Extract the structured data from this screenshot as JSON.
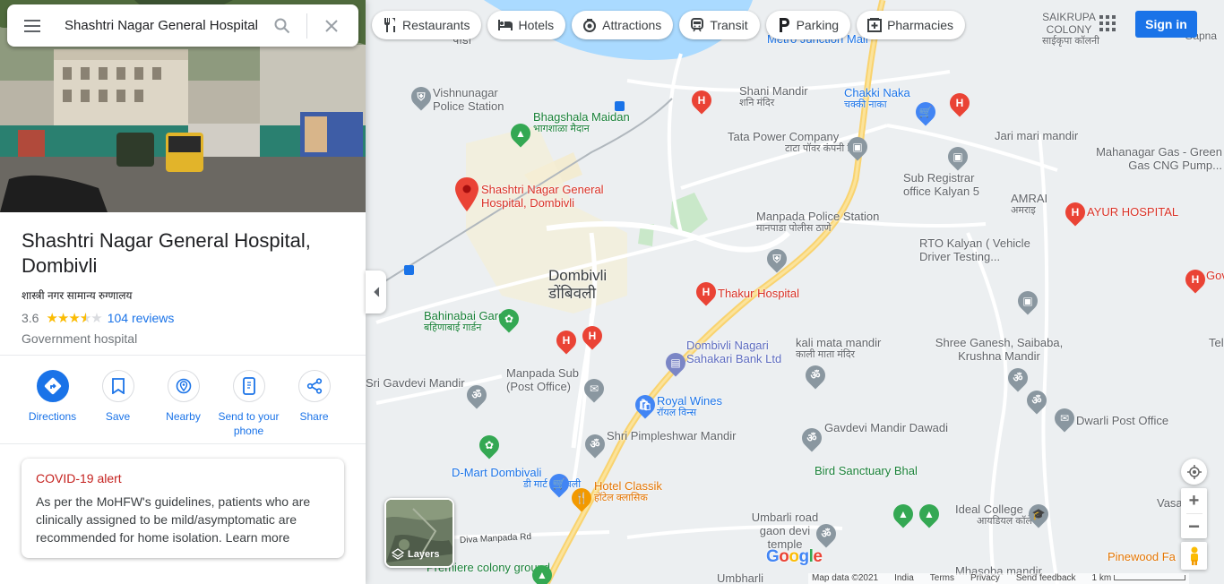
{
  "search": {
    "value": "Shashtri Nagar General Hospital, Dombivli"
  },
  "place": {
    "title": "Shashtri Nagar General Hospital, Dombivli",
    "subtitle": "शास्त्री नगर सामान्य रुग्णालय",
    "rating": "3.6",
    "rating_value": 3.6,
    "reviews": "104 reviews",
    "category": "Government hospital"
  },
  "actions": [
    {
      "label": "Directions",
      "icon": "directions-icon"
    },
    {
      "label": "Save",
      "icon": "bookmark-icon"
    },
    {
      "label": "Nearby",
      "icon": "nearby-icon"
    },
    {
      "label": "Send to your phone",
      "icon": "phone-icon"
    },
    {
      "label": "Share",
      "icon": "share-icon"
    }
  ],
  "covid": {
    "title": "COVID-19 alert",
    "text": "As per the MoHFW's guidelines, patients who are clinically assigned to be mild/asymptomatic are recommended for home isolation.",
    "link": "Learn more"
  },
  "chips": [
    {
      "label": "Restaurants",
      "icon": "fork-knife-icon"
    },
    {
      "label": "Hotels",
      "icon": "bed-icon"
    },
    {
      "label": "Attractions",
      "icon": "camera-icon"
    },
    {
      "label": "Transit",
      "icon": "train-icon"
    },
    {
      "label": "Parking",
      "icon": "parking-icon"
    },
    {
      "label": "Pharmacies",
      "icon": "pharmacy-icon"
    }
  ],
  "header": {
    "signin": "Sign in"
  },
  "layers": {
    "label": "Layers"
  },
  "footer": {
    "map_data": "Map data ©2021",
    "country": "India",
    "terms": "Terms",
    "privacy": "Privacy",
    "feedback": "Send feedback",
    "scale": "1 km"
  },
  "map_labels": {
    "selected_place": "Shashtri Nagar General Hospital, Dombivli",
    "dombivli": "Dombivli",
    "dombivli_mr": "डोंबिवली",
    "vishnunagar": "Vishnunagar Police Station",
    "bhagshala": "Bhagshala Maidan",
    "bhagshala_mr": "भागशाळा मैदान",
    "shani": "Shani Mandir",
    "shani_mr": "शनि मंदिर",
    "chakki": "Chakki Naka",
    "chakki_mr": "चक्की नाका",
    "tata": "Tata Power Company",
    "tata_mr": "टाटा पॉवर कंपनी लि",
    "jari": "Jari mari mandir",
    "saikrupa": "SAIKRUPA COLONY",
    "saikrupa_mr": "साईकृपा कॉलनी",
    "mahanagar": "Mahanagar Gas - Green Gas CNG Pump...",
    "subreg": "Sub Registrar office Kalyan 5",
    "amrai": "AMRAI",
    "amrai_mr": "अमराइ",
    "ayur": "AYUR HOSPITAL",
    "manpada_ps": "Manpada Police Station",
    "manpada_ps_mr": "मानपाडा पोलीस ठाणे",
    "rto": "RTO Kalyan ( Vehicle Driver Testing...",
    "bahinabai": "Bahinabai Garden",
    "bahinabai_mr": "बहिणाबाई गार्डन",
    "thakur": "Thakur Hospital",
    "nagari": "Dombivli Nagari Sahakari Bank Ltd",
    "kali": "kali mata mandir",
    "kali_mr": "काली माता मंदिर",
    "shree": "Shree Ganesh, Saibaba, Krushna Mandir",
    "srigavdevi": "Sri Gavdevi Mandir",
    "manpada_po": "Manpada Sub (Post Office)",
    "royal": "Royal Wines",
    "royal_mr": "रॉयल विन्स",
    "dwarli": "Dwarli Post Office",
    "pimpleshwar": "Shri Pimpleshwar Mandir",
    "gavdevi_dawadi": "Gavdevi Mandir Dawadi",
    "bird": "Bird Sanctuary Bhal",
    "dmart": "D-Mart Dombivali",
    "dmart_mr": "डी मार्ट डोंबिवली",
    "classik": "Hotel Classik",
    "classik_mr": "हॉटेल क्लासिक",
    "ideal": "Ideal College",
    "ideal_mr": "आयडियल कॉलेज",
    "umbarli": "Umbarli road gaon devi temple",
    "diva": "Diva Manpada Rd",
    "premiere": "Premiere colony ground",
    "pinewood": "Pinewood Fa",
    "metro": "Metro Junction Mall",
    "pada": "पाडा",
    "gov": "Gov",
    "vasa": "Vasa",
    "mhasoba": "Mhasoba mandir",
    "umbharli": "Umbharli",
    "tel": "Tel",
    "gapna": "Gapna"
  }
}
